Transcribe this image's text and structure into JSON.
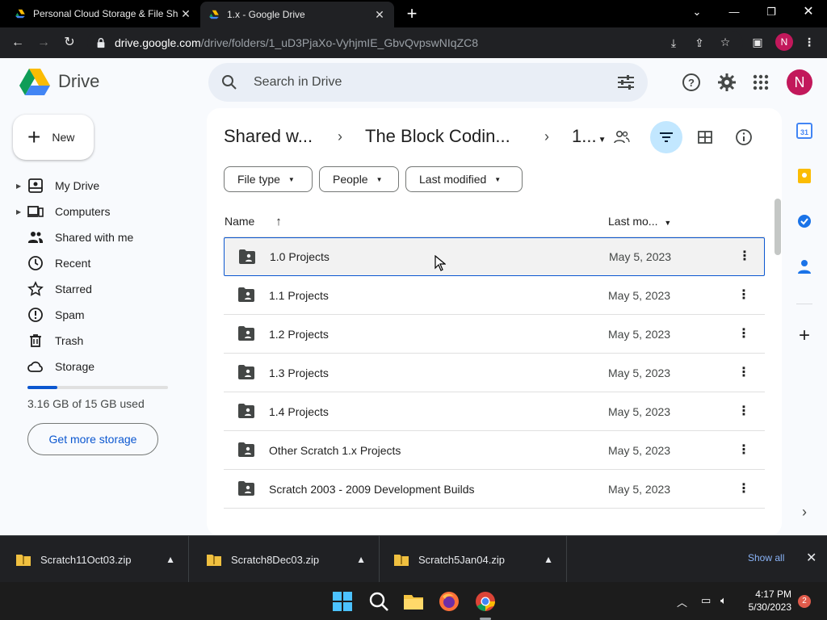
{
  "browser": {
    "tabs": [
      {
        "title": "Personal Cloud Storage & File Sh",
        "active": false
      },
      {
        "title": "1.x - Google Drive",
        "active": true
      }
    ],
    "url_host": "drive.google.com",
    "url_path": "/drive/folders/1_uD3PjaXo-VyhjmIE_GbvQvpswNIqZC8",
    "profile_initial": "N"
  },
  "drive": {
    "app_name": "Drive",
    "search_placeholder": "Search in Drive",
    "avatar_initial": "N",
    "new_label": "New",
    "nav": [
      {
        "label": "My Drive",
        "icon": "my-drive-icon"
      },
      {
        "label": "Computers",
        "icon": "computers-icon"
      },
      {
        "label": "Shared with me",
        "icon": "shared-icon"
      },
      {
        "label": "Recent",
        "icon": "clock-icon"
      },
      {
        "label": "Starred",
        "icon": "star-icon"
      },
      {
        "label": "Spam",
        "icon": "spam-icon"
      },
      {
        "label": "Trash",
        "icon": "trash-icon"
      },
      {
        "label": "Storage",
        "icon": "cloud-icon"
      }
    ],
    "storage": {
      "used_text": "3.16 GB of 15 GB used",
      "fraction": 0.21,
      "cta": "Get more storage"
    },
    "breadcrumb": [
      "Shared w...",
      "The Block Codin...",
      "1..."
    ],
    "filters": [
      "File type",
      "People",
      "Last modified"
    ],
    "columns": {
      "name": "Name",
      "modified": "Last mo..."
    },
    "rows": [
      {
        "name": "1.0 Projects",
        "date": "May 5, 2023",
        "selected": true
      },
      {
        "name": "1.1 Projects",
        "date": "May 5, 2023",
        "selected": false
      },
      {
        "name": "1.2 Projects",
        "date": "May 5, 2023",
        "selected": false
      },
      {
        "name": "1.3 Projects",
        "date": "May 5, 2023",
        "selected": false
      },
      {
        "name": "1.4 Projects",
        "date": "May 5, 2023",
        "selected": false
      },
      {
        "name": "Other Scratch 1.x Projects",
        "date": "May 5, 2023",
        "selected": false
      },
      {
        "name": "Scratch 2003 - 2009 Development Builds",
        "date": "May 5, 2023",
        "selected": false
      }
    ],
    "accent": "#0b57d0"
  },
  "downloads": {
    "items": [
      "Scratch11Oct03.zip",
      "Scratch8Dec03.zip",
      "Scratch5Jan04.zip"
    ],
    "show_all": "Show all"
  },
  "taskbar": {
    "time": "4:17 PM",
    "date": "5/30/2023",
    "notifications": "2"
  }
}
